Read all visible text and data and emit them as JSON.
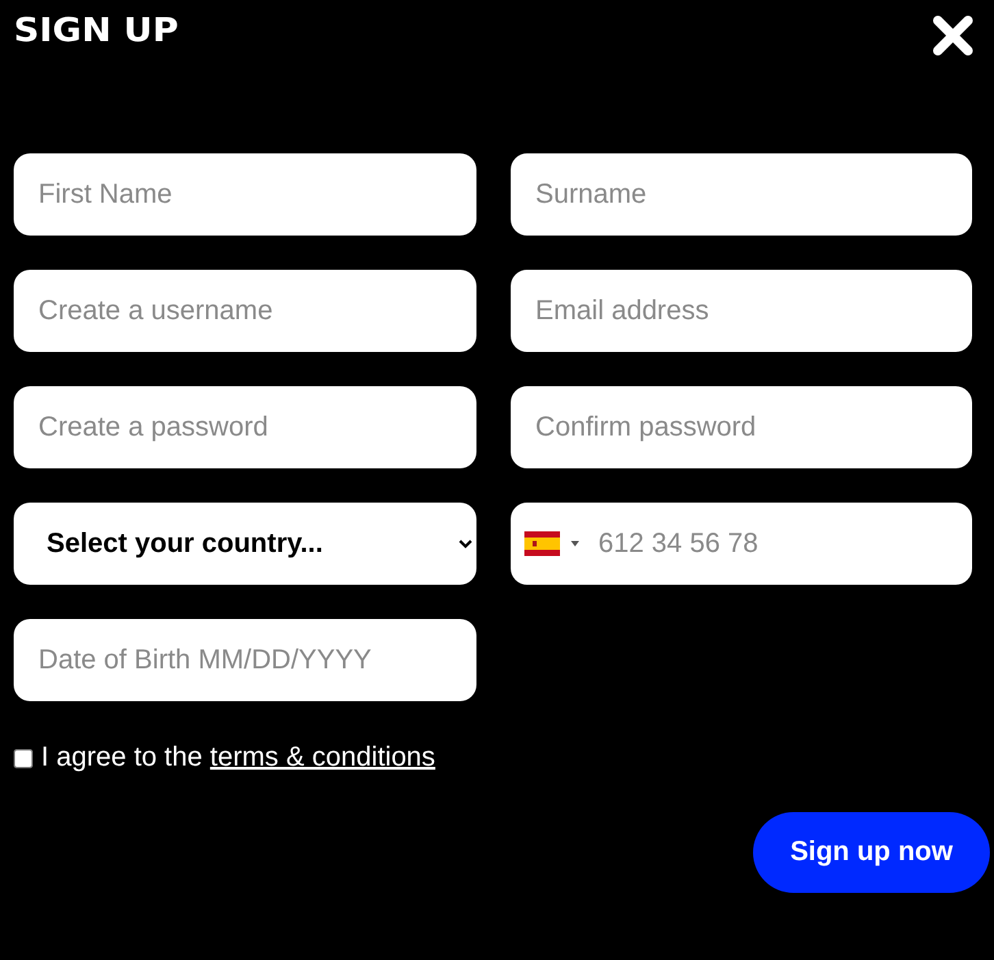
{
  "title": "SIGN UP",
  "fields": [
    {
      "kind": "text",
      "placeholder": "First Name"
    },
    {
      "kind": "text",
      "placeholder": "Surname"
    },
    {
      "kind": "text",
      "placeholder": "Create a username"
    },
    {
      "kind": "text",
      "placeholder": "Email address"
    },
    {
      "kind": "text",
      "placeholder": "Create a password"
    },
    {
      "kind": "text",
      "placeholder": "Confirm password"
    },
    {
      "kind": "select",
      "value": "Select your country..."
    },
    {
      "kind": "phone",
      "placeholder": "612 34 56 78"
    },
    {
      "kind": "text",
      "placeholder": "Date of Birth MM/DD/YYYY"
    }
  ],
  "agreement": {
    "checked": false,
    "text": "I agree to the ",
    "link": "terms & conditions"
  },
  "submit": "Sign up now"
}
